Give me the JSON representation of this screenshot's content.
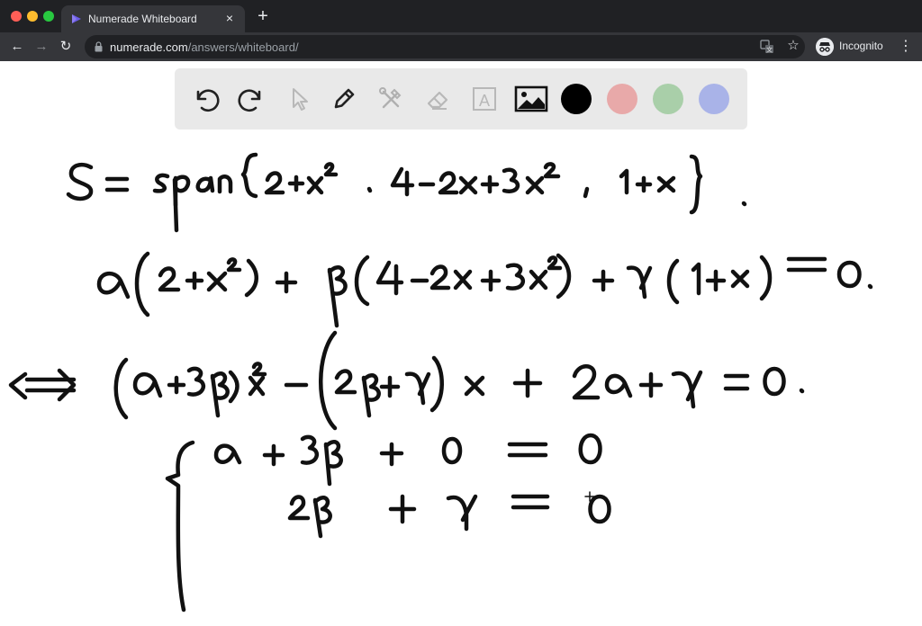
{
  "browser": {
    "tab_title": "Numerade Whiteboard",
    "close_glyph": "×",
    "new_tab_glyph": "+",
    "url_host": "numerade.com",
    "url_path": "/answers/whiteboard/",
    "profile_label": "Incognito",
    "back_glyph": "←",
    "forward_glyph": "→",
    "reload_glyph": "↻",
    "star_glyph": "☆",
    "menu_glyph": "⋮"
  },
  "whiteboard": {
    "tools": [
      {
        "name": "undo-icon"
      },
      {
        "name": "redo-icon"
      },
      {
        "name": "select-pointer-icon"
      },
      {
        "name": "pen-icon"
      },
      {
        "name": "tools-icon"
      },
      {
        "name": "eraser-icon"
      },
      {
        "name": "text-icon",
        "glyph": "A"
      },
      {
        "name": "image-icon"
      }
    ],
    "colors": [
      "#000000",
      "#e8a9a9",
      "#a9cfa9",
      "#a9b3e8"
    ],
    "selected_color": "#000000"
  }
}
